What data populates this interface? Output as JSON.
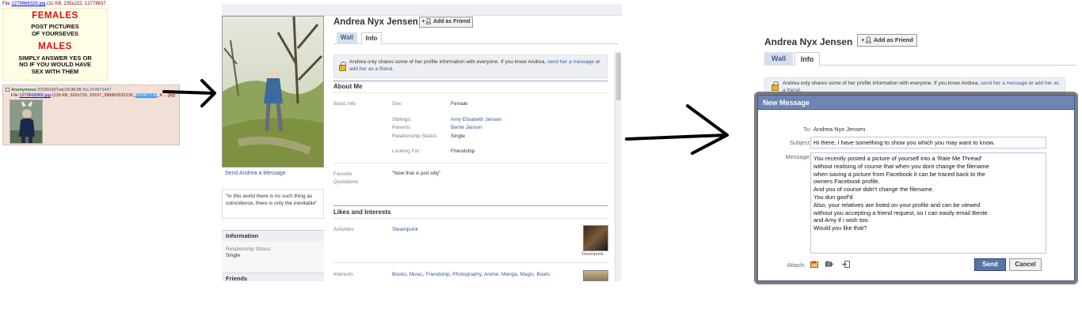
{
  "imageboard": {
    "file_prefix": "File",
    "op_filename": "1279666328.jpg",
    "op_fileinfo": "-(11 KB, 235x222, 12778637",
    "op_image": {
      "heading_females": "FEMALES",
      "females_text": [
        "POST PICTURES",
        "OF YOURSEVES"
      ],
      "heading_males": "MALES",
      "males_text": [
        "SIMPLY ANSWER YES OR",
        "NO IF YOU WOULD HAVE",
        "SEX WITH THEM"
      ]
    },
    "reply": {
      "name": "Anonymous",
      "datetime": "07/20/10(Tue)19:36:05",
      "post_no": "No.254973447",
      "file_prefix": "File",
      "filename": "1279668965.jpg",
      "fileinfo": "-(139 KB, 502x720, 29167_388860532130_",
      "selected": "582957130",
      "fileinfo_tail": "_4...",
      "tail_end": ".jpg)"
    }
  },
  "profile": {
    "name": "Andrea Nyx Jensen",
    "add_friend_label": "Add as Friend",
    "tabs": [
      {
        "label": "Wall"
      },
      {
        "label": "Info"
      }
    ],
    "privacy_notice": {
      "text": "Andrea only shares some of her profile information with everyone. If you know Andrea,",
      "link1": "send her a message",
      "mid": "or",
      "link2": "add her as a friend",
      "end": "."
    },
    "send_message_link": "Send Andrea a Message",
    "quote": "\"In this world there is no such thing as coincidence, there is only the inevitable\"",
    "left_sections": {
      "information_title": "Information",
      "relationship_label": "Relationship Status:",
      "relationship_value": "Single",
      "friends_title": "Friends"
    },
    "about_me": {
      "title": "About Me",
      "basic_info_label": "Basic Info",
      "fields": [
        {
          "label": "Sex:",
          "value": "Female",
          "link": false
        },
        {
          "label": "Siblings:",
          "value": "Amy Elisabeth Jensen",
          "link": true
        },
        {
          "label": "Parents:",
          "value": "Bente Janson",
          "link": true
        },
        {
          "label": "Relationship Status:",
          "value": "Single",
          "link": false
        },
        {
          "label": "Looking For:",
          "value": "Friendship",
          "link": false
        }
      ],
      "favorite_quotations_label": "Favorite Quotations",
      "favorite_quotations_value": "\"Now that is just silly\""
    },
    "likes": {
      "title": "Likes and Interests",
      "activities_label": "Activities",
      "activities_value": "Steampunk",
      "activities_thumb_caption": "Steampunk",
      "interests_label": "Interests",
      "interests": [
        "Books",
        "Music",
        "Friendship",
        "Photography",
        "Anime",
        "Manga",
        "Magic",
        "Boats"
      ]
    }
  },
  "message_dialog": {
    "title": "New Message",
    "to_label": "To:",
    "to_value": "Andrea Nyx Jensen",
    "subject_label": "Subject:",
    "subject_value": "Hi there, I have something to show you which you may want to know.",
    "message_label": "Message:",
    "message_lines": [
      "You recently posted a picture of yourself into a 'Rate Me Thread'",
      "without realising of course that when you dont change the filename",
      "when saving a picture from Facebook it can be traced back to the",
      "owners Facebook profile.",
      "And you of course didn't change the filename.",
      "You dun goof'd",
      "Also,  your relatives are listed on your profile and can be viewed",
      "without you accepting a friend request, so I can easily email Bente",
      "and Amy if i wish too.",
      "Would you like that?"
    ],
    "attach_label": "Attach:",
    "send_label": "Send",
    "cancel_label": "Cancel"
  },
  "colors": {
    "fb_blue": "#3b5998",
    "dialog_title": "#6d84b4",
    "imageboard_reply_bg": "#f0e0d6",
    "warning_red": "#e01010"
  }
}
